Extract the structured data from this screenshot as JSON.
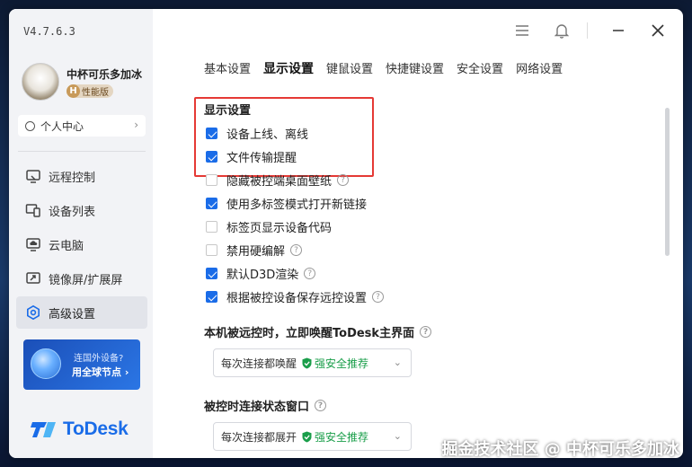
{
  "app": {
    "version": "V4.7.6.3",
    "username": "中杯可乐多加冰",
    "badge_letter": "H",
    "badge_label": "性能版",
    "personal_center": "个人中心"
  },
  "sidebar": {
    "items": [
      {
        "label": "远程控制",
        "icon": "remote-control-icon"
      },
      {
        "label": "设备列表",
        "icon": "device-list-icon"
      },
      {
        "label": "云电脑",
        "icon": "cloud-pc-icon"
      },
      {
        "label": "镜像屏/扩展屏",
        "icon": "mirror-screen-icon"
      },
      {
        "label": "高级设置",
        "icon": "advanced-settings-icon",
        "active": true
      }
    ],
    "promo": {
      "line1": "连国外设备?",
      "line2": "用全球节点 ›"
    },
    "logo_text": "ToDesk"
  },
  "tabs": [
    {
      "label": "基本设置",
      "active": false
    },
    {
      "label": "显示设置",
      "active": true
    },
    {
      "label": "键鼠设置",
      "active": false
    },
    {
      "label": "快捷键设置",
      "active": false
    },
    {
      "label": "安全设置",
      "active": false
    },
    {
      "label": "网络设置",
      "active": false
    }
  ],
  "display_settings": {
    "title": "显示设置",
    "options": [
      {
        "label": "设备上线、离线",
        "checked": true,
        "help": false
      },
      {
        "label": "文件传输提醒",
        "checked": true,
        "help": false
      },
      {
        "label": "隐藏被控端桌面壁纸",
        "checked": false,
        "help": true
      },
      {
        "label": "使用多标签模式打开新链接",
        "checked": true,
        "help": false
      },
      {
        "label": "标签页显示设备代码",
        "checked": false,
        "help": false
      },
      {
        "label": "禁用硬编解",
        "checked": false,
        "help": true
      },
      {
        "label": "默认D3D渲染",
        "checked": true,
        "help": true
      },
      {
        "label": "根据被控设备保存远控设置",
        "checked": true,
        "help": true
      }
    ]
  },
  "wake_section": {
    "title": "本机被远控时，立即唤醒ToDesk主界面",
    "select_value": "每次连接都唤醒",
    "recommend": "强安全推荐"
  },
  "window_section": {
    "title": "被控时连接状态窗口",
    "select_value": "每次连接都展开",
    "recommend": "强安全推荐"
  },
  "watermark": "掘金技术社区 @ 中杯可乐多加冰",
  "colors": {
    "accent": "#1a6ce8",
    "highlight_box": "#e53935",
    "recommend": "#1a9e4a"
  }
}
